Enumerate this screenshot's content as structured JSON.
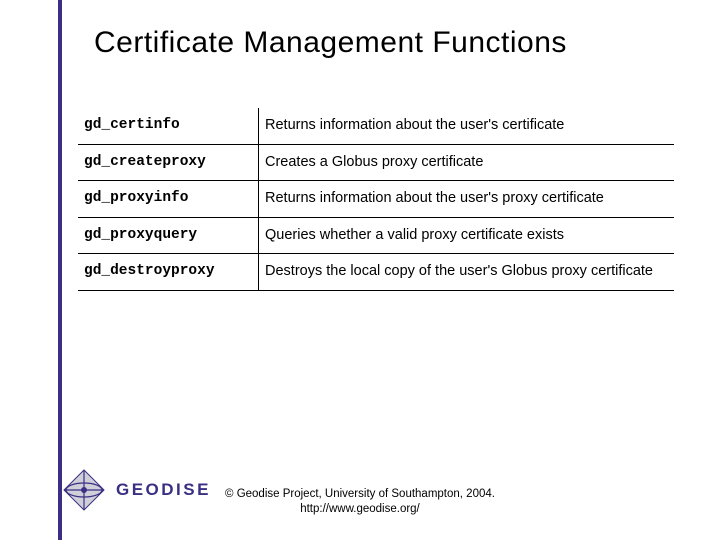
{
  "title": "Certificate Management Functions",
  "rows": [
    {
      "fn": "gd_certinfo",
      "desc": "Returns information about the user's certificate"
    },
    {
      "fn": "gd_createproxy",
      "desc": "Creates a Globus proxy certificate"
    },
    {
      "fn": "gd_proxyinfo",
      "desc": "Returns information about the user's proxy certificate"
    },
    {
      "fn": "gd_proxyquery",
      "desc": "Queries whether a valid proxy certificate exists"
    },
    {
      "fn": "gd_destroyproxy",
      "desc": "Destroys the local copy of the user's Globus proxy certificate"
    }
  ],
  "logo": {
    "text": "GEODISE"
  },
  "footer": {
    "line1": "© Geodise Project, University of Southampton, 2004.",
    "line2": "http://www.geodise.org/"
  }
}
